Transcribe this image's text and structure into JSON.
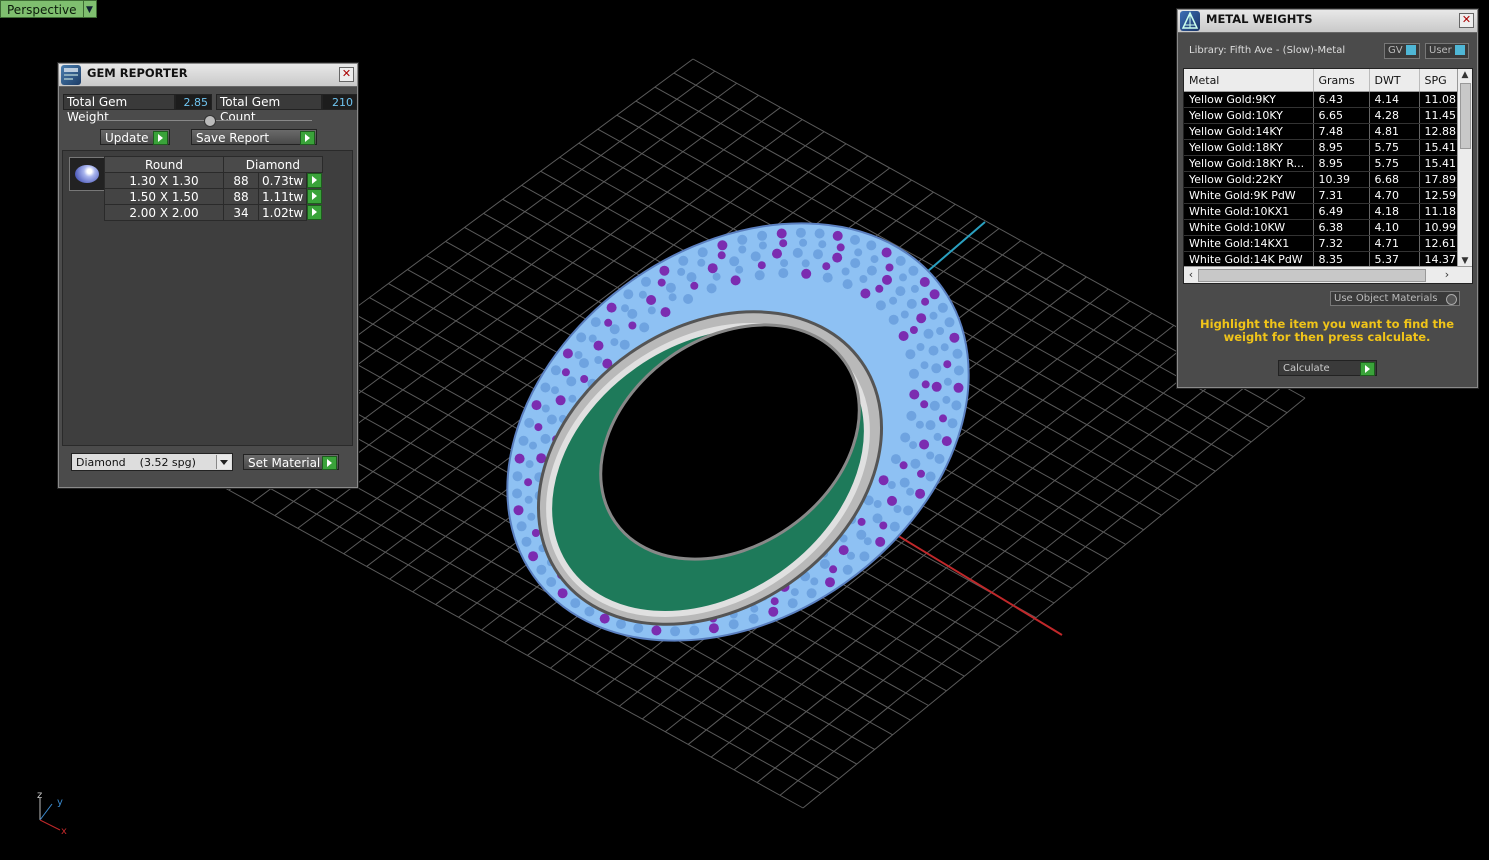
{
  "viewport": {
    "label": "Perspective"
  },
  "colors": {
    "grid": "#5a5a5a",
    "gem_fill": "#8ec1f3",
    "prong": "#7b2cb0",
    "shank_inner": "#1e7a5a",
    "axis_x": "#c0282a",
    "axis_z": "#2aa0c0",
    "hint_text": "#f0c419",
    "value_text": "#6fc4f0",
    "go_button": "#3aa33a"
  },
  "gem_reporter": {
    "title": "GEM REPORTER",
    "icon": "gem-reporter-icon",
    "total_weight_label": "Total Gem Weight",
    "total_weight_value": "2.85",
    "total_count_label": "Total Gem Count",
    "total_count_value": "210",
    "update_label": "Update",
    "save_report_label": "Save Report",
    "table": {
      "headers": [
        "Round",
        "Diamond"
      ],
      "rows": [
        {
          "size": "1.30 X 1.30",
          "count": "88",
          "weight": "0.73tw"
        },
        {
          "size": "1.50 X 1.50",
          "count": "88",
          "weight": "1.11tw"
        },
        {
          "size": "2.00 X 2.00",
          "count": "34",
          "weight": "1.02tw"
        }
      ]
    },
    "material_select": "Diamond    (3.52 spg)",
    "set_material_label": "Set Material"
  },
  "metal_weights": {
    "title": "METAL WEIGHTS",
    "icon": "metal-weights-icon",
    "library": "Library: Fifth Ave - (Slow)-Metal",
    "gv_label": "GV",
    "user_label": "User",
    "columns": [
      "Metal",
      "Grams",
      "DWT",
      "SPG"
    ],
    "rows": [
      {
        "metal": "Yellow Gold:9KY",
        "grams": "6.43",
        "dwt": "4.14",
        "spg": "11.08"
      },
      {
        "metal": "Yellow Gold:10KY",
        "grams": "6.65",
        "dwt": "4.28",
        "spg": "11.45"
      },
      {
        "metal": "Yellow Gold:14KY",
        "grams": "7.48",
        "dwt": "4.81",
        "spg": "12.88"
      },
      {
        "metal": "Yellow Gold:18KY",
        "grams": "8.95",
        "dwt": "5.75",
        "spg": "15.41"
      },
      {
        "metal": "Yellow Gold:18KY R...",
        "grams": "8.95",
        "dwt": "5.75",
        "spg": "15.41"
      },
      {
        "metal": "Yellow Gold:22KY",
        "grams": "10.39",
        "dwt": "6.68",
        "spg": "17.89"
      },
      {
        "metal": "White Gold:9K PdW",
        "grams": "7.31",
        "dwt": "4.70",
        "spg": "12.59"
      },
      {
        "metal": "White Gold:10KX1",
        "grams": "6.49",
        "dwt": "4.18",
        "spg": "11.18"
      },
      {
        "metal": "White Gold:10KW",
        "grams": "6.38",
        "dwt": "4.10",
        "spg": "10.99"
      },
      {
        "metal": "White Gold:14KX1",
        "grams": "7.32",
        "dwt": "4.71",
        "spg": "12.61"
      },
      {
        "metal": "White Gold:14K PdW",
        "grams": "8.35",
        "dwt": "5.37",
        "spg": "14.37"
      }
    ],
    "use_object_materials_label": "Use Object Materials",
    "hint": "Highlight the item you want to find the weight for then press calculate.",
    "calculate_label": "Calculate"
  },
  "axis_widget": {
    "x": "x",
    "y": "y",
    "z": "z"
  }
}
